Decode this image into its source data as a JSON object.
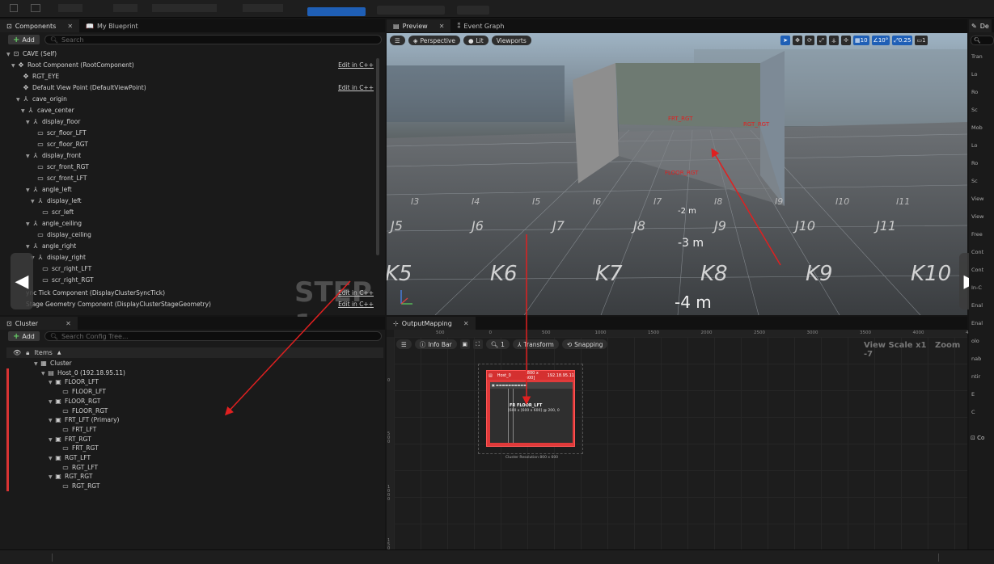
{
  "top_toolbar": {
    "items": [
      "",
      "",
      "",
      "",
      "",
      ""
    ]
  },
  "components_panel": {
    "tab_label": "Components",
    "tab2_label": "My Blueprint",
    "add_label": "Add",
    "search_placeholder": "Search",
    "tree": [
      {
        "label": "CAVE (Self)",
        "depth": 0,
        "icon": "class-icon",
        "cpp": ""
      },
      {
        "label": "Root Component (RootComponent)",
        "depth": 1,
        "icon": "component-icon",
        "cpp": "Edit in C++"
      },
      {
        "label": "RGT_EYE",
        "depth": 2,
        "icon": "component-icon",
        "cpp": ""
      },
      {
        "label": "Default View Point (DefaultViewPoint)",
        "depth": 2,
        "icon": "component-icon",
        "cpp": "Edit in C++"
      },
      {
        "label": "cave_origin",
        "depth": 2,
        "icon": "axis-icon",
        "cpp": ""
      },
      {
        "label": "cave_center",
        "depth": 3,
        "icon": "axis-icon",
        "cpp": ""
      },
      {
        "label": "display_floor",
        "depth": 4,
        "icon": "axis-icon",
        "cpp": ""
      },
      {
        "label": "scr_floor_LFT",
        "depth": 5,
        "icon": "screen-icon",
        "cpp": ""
      },
      {
        "label": "scr_floor_RGT",
        "depth": 5,
        "icon": "screen-icon",
        "cpp": ""
      },
      {
        "label": "display_front",
        "depth": 4,
        "icon": "axis-icon",
        "cpp": ""
      },
      {
        "label": "scr_front_RGT",
        "depth": 5,
        "icon": "screen-icon",
        "cpp": ""
      },
      {
        "label": "scr_front_LFT",
        "depth": 5,
        "icon": "screen-icon",
        "cpp": ""
      },
      {
        "label": "angle_left",
        "depth": 4,
        "icon": "axis-icon",
        "cpp": ""
      },
      {
        "label": "display_left",
        "depth": 5,
        "icon": "axis-icon",
        "cpp": ""
      },
      {
        "label": "scr_left",
        "depth": 6,
        "icon": "screen-icon",
        "cpp": ""
      },
      {
        "label": "angle_ceiling",
        "depth": 4,
        "icon": "axis-icon",
        "cpp": ""
      },
      {
        "label": "display_ceiling",
        "depth": 5,
        "icon": "screen-icon",
        "cpp": ""
      },
      {
        "label": "angle_right",
        "depth": 4,
        "icon": "axis-icon",
        "cpp": ""
      },
      {
        "label": "display_right",
        "depth": 5,
        "icon": "axis-icon",
        "cpp": ""
      },
      {
        "label": "scr_right_LFT",
        "depth": 6,
        "icon": "screen-icon",
        "cpp": ""
      },
      {
        "label": "scr_right_RGT",
        "depth": 6,
        "icon": "screen-icon",
        "cpp": ""
      }
    ],
    "extra_rows": [
      {
        "label": "ync Tick Component (DisplayClusterSyncTick)",
        "cpp": "Edit in C++"
      },
      {
        "label": "Stage Geometry Component (DisplayClusterStageGeometry)",
        "cpp": "Edit in C++"
      }
    ],
    "step_watermark": "STEP 1"
  },
  "cluster_panel": {
    "tab_label": "Cluster",
    "add_label": "Add",
    "search_placeholder": "Search Config Tree...",
    "header_label": "Items",
    "tree": [
      {
        "label": "Cluster",
        "depth": 0,
        "icon": "cluster-icon"
      },
      {
        "label": "Host_0 (192.18.95.11)",
        "depth": 1,
        "icon": "host-icon"
      },
      {
        "label": "FLOOR_LFT",
        "depth": 2,
        "icon": "node-icon"
      },
      {
        "label": "FLOOR_LFT",
        "depth": 3,
        "icon": "viewport-icon"
      },
      {
        "label": "FLOOR_RGT",
        "depth": 2,
        "icon": "node-icon"
      },
      {
        "label": "FLOOR_RGT",
        "depth": 3,
        "icon": "viewport-icon"
      },
      {
        "label": "FRT_LFT (Primary)",
        "depth": 2,
        "icon": "node-icon"
      },
      {
        "label": "FRT_LFT",
        "depth": 3,
        "icon": "viewport-icon"
      },
      {
        "label": "FRT_RGT",
        "depth": 2,
        "icon": "node-icon"
      },
      {
        "label": "FRT_RGT",
        "depth": 3,
        "icon": "viewport-icon"
      },
      {
        "label": "RGT_LFT",
        "depth": 2,
        "icon": "node-icon"
      },
      {
        "label": "RGT_LFT",
        "depth": 3,
        "icon": "viewport-icon"
      },
      {
        "label": "RGT_RGT",
        "depth": 2,
        "icon": "node-icon"
      },
      {
        "label": "RGT_RGT",
        "depth": 3,
        "icon": "viewport-icon"
      }
    ]
  },
  "preview_panel": {
    "tab_label": "Preview",
    "tab2_label": "Event Graph",
    "perspective_label": "Perspective",
    "lit_label": "Lit",
    "viewports_label": "Viewports",
    "grid_value": "10",
    "angle_value": "10°",
    "scale_value": "0.25",
    "camera_speed": "1",
    "scene_labels": {
      "front": "FRT_RGT",
      "right": "RGT_RGT",
      "floor": "FLOOR_RGT"
    },
    "floor_cells_row1": [
      "I3",
      "I4",
      "I5",
      "I6",
      "I7",
      "I8",
      "I9",
      "I10",
      "I11"
    ],
    "floor_cells_row2": [
      "J5",
      "J6",
      "J7",
      "J8",
      "J9",
      "J10",
      "J11"
    ],
    "floor_cells_row3": [
      "K5",
      "K6",
      "K7",
      "K8",
      "K9",
      "K10"
    ],
    "distance_labels": [
      "2 m",
      "3 m",
      "4 m"
    ]
  },
  "output_mapping": {
    "tab_label": "OutputMapping",
    "info_bar_label": "Info Bar",
    "zoom_value": "1",
    "transform_label": "Transform",
    "snapping_label": "Snapping",
    "view_scale": "View Scale x1",
    "zoom_label": "Zoom -7",
    "ruler_top": [
      "500",
      "0",
      "500",
      "1000",
      "1500",
      "2000",
      "2500",
      "3000",
      "3500",
      "4000",
      "45"
    ],
    "ruler_left": [
      "0",
      "500",
      "1000",
      "1500"
    ],
    "host_name": "Host_0",
    "host_res": "[800 x 600]",
    "host_ip": "192.18.95.11",
    "node_line": "FR  FLOOR_LFT",
    "node_sub": "[600 x [600 x 600] @ 200, 0",
    "cluster_resolution": "Cluster Resolution 800 x 600"
  },
  "details_panel": {
    "tab_label": "De",
    "rows": [
      "Tran",
      "Lo",
      "Ro",
      "Sc",
      "Mob",
      "Lo",
      "Ro",
      "Sc",
      "View",
      "View",
      "Free",
      "Cont",
      "Cont",
      "In-C",
      "Enal",
      "Enal",
      "olo",
      "nab",
      "ntir",
      "E",
      "C"
    ],
    "bottom_label": "Co"
  },
  "colors": {
    "accent_blue": "#1f5fb6",
    "annotation_red": "#e02020",
    "add_green": "#5cb85c"
  }
}
